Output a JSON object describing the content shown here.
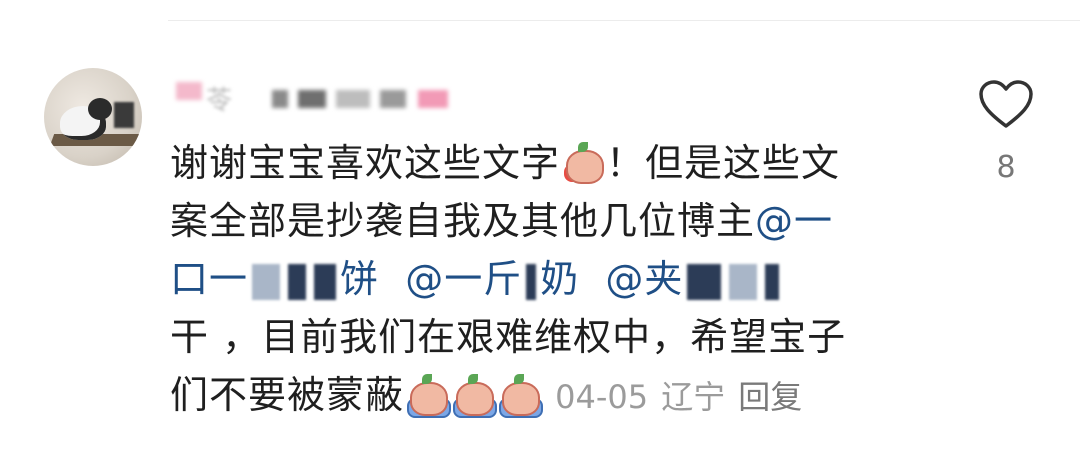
{
  "comment": {
    "username_prefix": "苓",
    "line1": "谢谢宝宝喜欢这些文字",
    "line1_suffix": "！但是这些文",
    "line2": "案全部是抄袭自我及其他几位博主",
    "line2_mention": "@一",
    "line3_a": "口一",
    "line3_b": "饼",
    "line3_c": "@一斤",
    "line3_d": "奶",
    "line3_e": "@夹",
    "line4": "干 ，目前我们在艰难维权中，希望宝子",
    "line5": "们不要被蒙蔽",
    "date": "04-05",
    "location": "辽宁",
    "reply_label": "回复"
  },
  "like": {
    "count": "8",
    "icon": "heart-outline-icon"
  },
  "colors": {
    "text": "#1f1f1f",
    "mention": "#1f4f86",
    "meta": "#9b9b9b"
  }
}
